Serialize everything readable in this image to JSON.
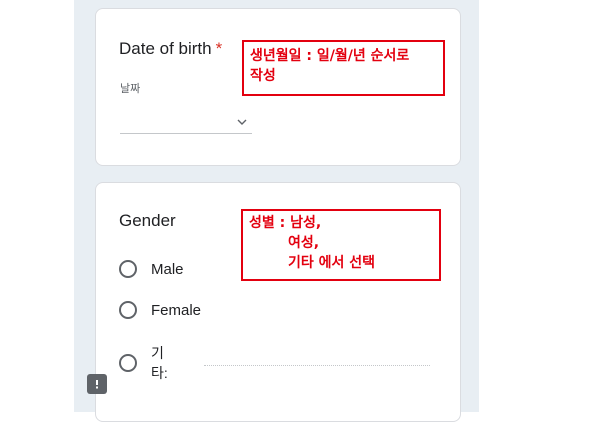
{
  "dob": {
    "title": "Date of birth",
    "required_mark": "*",
    "hint": "날짜",
    "icon": "chevron-down-icon"
  },
  "gender": {
    "title": "Gender",
    "options": [
      "Male",
      "Female"
    ],
    "other_label_line1": "기",
    "other_label_line2": "타:"
  },
  "annotations": {
    "dob_line1": "생년월일 : 일/월/년 순서로",
    "dob_line2": "작성",
    "gender_line1": "성별 : 남성,",
    "gender_line2": "        여성,",
    "gender_line3": "        기타 에서 선택"
  },
  "report_icon": "report-problem-icon",
  "colors": {
    "background_strip": "#e8eef3",
    "required": "#d93025",
    "annotation": "#e3000f"
  }
}
